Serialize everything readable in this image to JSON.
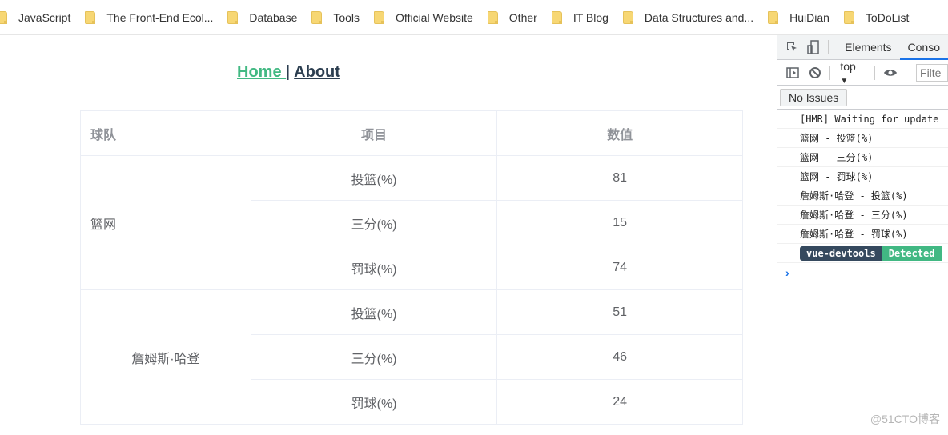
{
  "bookmarks": [
    {
      "label": "JavaScript",
      "icon": "folder-icon"
    },
    {
      "label": "The Front-End Ecol...",
      "icon": "folder-icon"
    },
    {
      "label": "Database",
      "icon": "folder-icon"
    },
    {
      "label": "Tools",
      "icon": "folder-icon"
    },
    {
      "label": "Official Website",
      "icon": "folder-icon"
    },
    {
      "label": "Other",
      "icon": "folder-icon"
    },
    {
      "label": "IT Blog",
      "icon": "folder-icon"
    },
    {
      "label": "Data Structures and...",
      "icon": "folder-icon"
    },
    {
      "label": "HuiDian",
      "icon": "folder-icon"
    },
    {
      "label": "ToDoList",
      "icon": "folder-icon"
    }
  ],
  "nav": {
    "home": "Home ",
    "separator": "|",
    "about": "About",
    "home_color": "#42b983",
    "about_color": "#2c3e50"
  },
  "table": {
    "headers": [
      "球队",
      "项目",
      "数值"
    ],
    "groups": [
      {
        "team": "篮网",
        "rows": [
          {
            "item": "投篮(%)",
            "value": "81"
          },
          {
            "item": "三分(%)",
            "value": "15"
          },
          {
            "item": "罚球(%)",
            "value": "74"
          }
        ]
      },
      {
        "team": "詹姆斯·哈登",
        "rows": [
          {
            "item": "投篮(%)",
            "value": "51"
          },
          {
            "item": "三分(%)",
            "value": "46"
          },
          {
            "item": "罚球(%)",
            "value": "24"
          }
        ]
      }
    ]
  },
  "devtools": {
    "tabs": [
      "Elements",
      "Conso"
    ],
    "active_tab": "Console",
    "context": "top",
    "filter_placeholder": "Filte",
    "issues_label": "No Issues",
    "console_lines": [
      "[HMR] Waiting for update",
      "篮网 - 投篮(%)",
      "篮网 - 三分(%)",
      "篮网 - 罚球(%)",
      "詹姆斯·哈登 - 投篮(%)",
      "詹姆斯·哈登 - 三分(%)",
      "詹姆斯·哈登 - 罚球(%)"
    ],
    "badge_left": "vue-devtools",
    "badge_right": "Detected",
    "prompt": "›"
  },
  "watermark": "@51CTO博客"
}
